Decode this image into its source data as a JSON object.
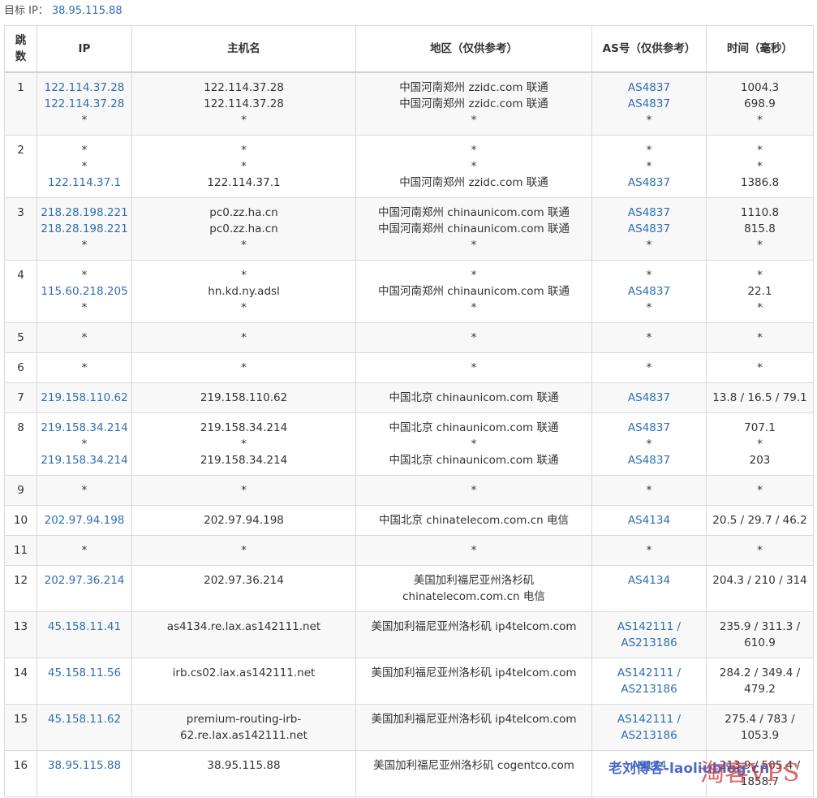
{
  "target": {
    "label": "目标 IP：",
    "ip": "38.95.115.88"
  },
  "headers": {
    "hop": [
      "跳",
      "数"
    ],
    "ip": "IP",
    "host": "主机名",
    "region": "地区（仅供参考）",
    "as": "AS号（仅供参考）",
    "time": "时间（毫秒）"
  },
  "rows": [
    {
      "hop": "1",
      "ip": [
        "122.114.37.28",
        "122.114.37.28",
        "*"
      ],
      "host": [
        "122.114.37.28",
        "122.114.37.28",
        "*"
      ],
      "region": [
        "中国河南郑州 zzidc.com 联通",
        "中国河南郑州 zzidc.com 联通",
        "*"
      ],
      "as": [
        "AS4837",
        "AS4837",
        "*"
      ],
      "time": [
        "1004.3",
        "698.9",
        "*"
      ]
    },
    {
      "hop": "2",
      "ip": [
        "*",
        "*",
        "122.114.37.1"
      ],
      "host": [
        "*",
        "*",
        "122.114.37.1"
      ],
      "region": [
        "*",
        "*",
        "中国河南郑州 zzidc.com 联通"
      ],
      "as": [
        "*",
        "*",
        "AS4837"
      ],
      "time": [
        "*",
        "*",
        "1386.8"
      ]
    },
    {
      "hop": "3",
      "ip": [
        "218.28.198.221",
        "218.28.198.221",
        "*"
      ],
      "host": [
        "pc0.zz.ha.cn",
        "pc0.zz.ha.cn",
        "*"
      ],
      "region": [
        "中国河南郑州 chinaunicom.com 联通",
        "中国河南郑州 chinaunicom.com 联通",
        "*"
      ],
      "as": [
        "AS4837",
        "AS4837",
        "*"
      ],
      "time": [
        "1110.8",
        "815.8",
        "*"
      ]
    },
    {
      "hop": "4",
      "ip": [
        "*",
        "115.60.218.205",
        "*"
      ],
      "host": [
        "*",
        "hn.kd.ny.adsl",
        "*"
      ],
      "region": [
        "*",
        "中国河南郑州 chinaunicom.com 联通",
        "*"
      ],
      "as": [
        "*",
        "AS4837",
        "*"
      ],
      "time": [
        "*",
        "22.1",
        "*"
      ]
    },
    {
      "hop": "5",
      "ip": [
        "*"
      ],
      "host": [
        "*"
      ],
      "region": [
        "*"
      ],
      "as": [
        "*"
      ],
      "time": [
        "*"
      ]
    },
    {
      "hop": "6",
      "ip": [
        "*"
      ],
      "host": [
        "*"
      ],
      "region": [
        "*"
      ],
      "as": [
        "*"
      ],
      "time": [
        "*"
      ]
    },
    {
      "hop": "7",
      "ip": [
        "219.158.110.62"
      ],
      "host": [
        "219.158.110.62"
      ],
      "region": [
        "中国北京 chinaunicom.com 联通"
      ],
      "as": [
        "AS4837"
      ],
      "time": [
        "13.8 / 16.5 / 79.1"
      ]
    },
    {
      "hop": "8",
      "ip": [
        "219.158.34.214",
        "*",
        "219.158.34.214"
      ],
      "host": [
        "219.158.34.214",
        "*",
        "219.158.34.214"
      ],
      "region": [
        "中国北京 chinaunicom.com 联通",
        "*",
        "中国北京 chinaunicom.com 联通"
      ],
      "as": [
        "AS4837",
        "*",
        "AS4837"
      ],
      "time": [
        "707.1",
        "*",
        "203"
      ]
    },
    {
      "hop": "9",
      "ip": [
        "*"
      ],
      "host": [
        "*"
      ],
      "region": [
        "*"
      ],
      "as": [
        "*"
      ],
      "time": [
        "*"
      ]
    },
    {
      "hop": "10",
      "ip": [
        "202.97.94.198"
      ],
      "host": [
        "202.97.94.198"
      ],
      "region": [
        "中国北京 chinatelecom.com.cn 电信"
      ],
      "as": [
        "AS4134"
      ],
      "time": [
        "20.5 / 29.7 / 46.2"
      ]
    },
    {
      "hop": "11",
      "ip": [
        "*"
      ],
      "host": [
        "*"
      ],
      "region": [
        "*"
      ],
      "as": [
        "*"
      ],
      "time": [
        "*"
      ]
    },
    {
      "hop": "12",
      "ip": [
        "202.97.36.214"
      ],
      "host": [
        "202.97.36.214"
      ],
      "region": [
        "美国加利福尼亚州洛杉矶",
        "chinatelecom.com.cn 电信"
      ],
      "as": [
        "AS4134"
      ],
      "time": [
        "204.3 / 210 / 314"
      ]
    },
    {
      "hop": "13",
      "ip": [
        "45.158.11.41"
      ],
      "host": [
        "as4134.re.lax.as142111.net"
      ],
      "region": [
        "美国加利福尼亚州洛杉矶 ip4telcom.com"
      ],
      "as": [
        "AS142111 /",
        "AS213186"
      ],
      "time": [
        "235.9 / 311.3 /",
        "610.9"
      ]
    },
    {
      "hop": "14",
      "ip": [
        "45.158.11.56"
      ],
      "host": [
        "irb.cs02.lax.as142111.net"
      ],
      "region": [
        "美国加利福尼亚州洛杉矶 ip4telcom.com"
      ],
      "as": [
        "AS142111 /",
        "AS213186"
      ],
      "time": [
        "284.2 / 349.4 /",
        "479.2"
      ]
    },
    {
      "hop": "15",
      "ip": [
        "45.158.11.62"
      ],
      "host": [
        "premium-routing-irb-",
        "62.re.lax.as142111.net"
      ],
      "region": [
        "美国加利福尼亚州洛杉矶 ip4telcom.com"
      ],
      "as": [
        "AS142111 /",
        "AS213186"
      ],
      "time": [
        "275.4 / 783 /",
        "1053.9"
      ]
    },
    {
      "hop": "16",
      "ip": [
        "38.95.115.88"
      ],
      "host": [
        "38.95.115.88"
      ],
      "region": [
        "美国加利福尼亚州洛杉矶 cogentco.com"
      ],
      "as": [
        "AS174"
      ],
      "time": [
        "213.9 / 505.4 /",
        "1858.7"
      ]
    }
  ],
  "watermarks": {
    "blog": "老刘博客-laoliublog.cn",
    "brand": "淘客VPS"
  },
  "colors": {
    "link": "#2f6fb0",
    "row_alt": "#f8f8f8",
    "border": "#d9d9d9"
  }
}
